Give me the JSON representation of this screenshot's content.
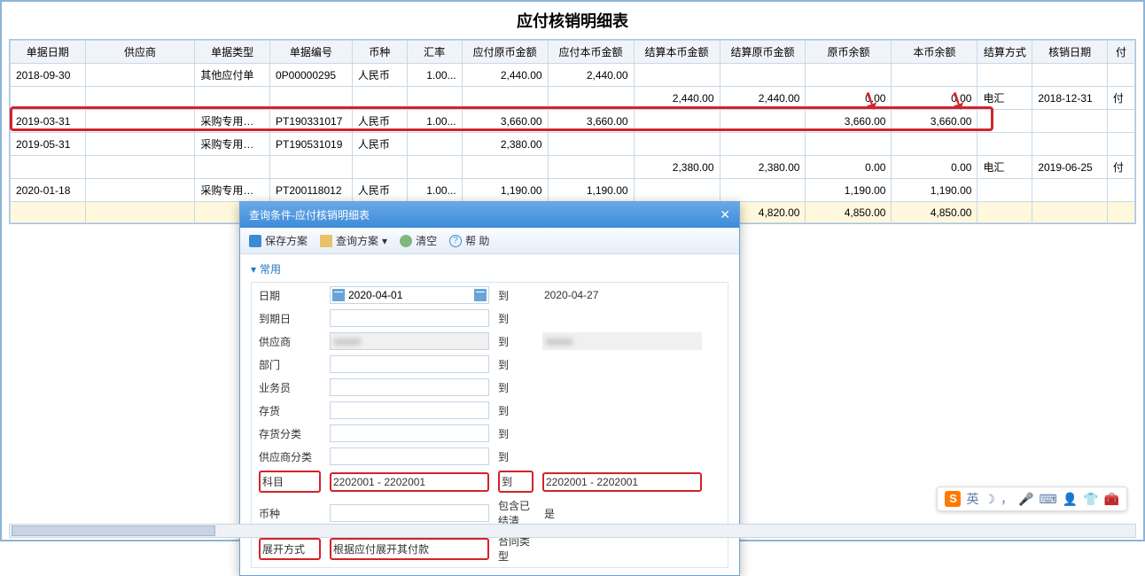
{
  "page_title": "应付核销明细表",
  "columns": [
    "单据日期",
    "供应商",
    "单据类型",
    "单据编号",
    "币种",
    "汇率",
    "应付原币金额",
    "应付本币金额",
    "结算本币金额",
    "结算原币金额",
    "原币余额",
    "本币余额",
    "结算方式",
    "核销日期",
    "付"
  ],
  "rows": [
    {
      "c": [
        "2018-09-30",
        "",
        "其他应付单",
        "0P00000295",
        "人民币",
        "1.00...",
        "2,440.00",
        "2,440.00",
        "",
        "",
        "",
        "",
        "",
        "",
        ""
      ]
    },
    {
      "c": [
        "",
        "",
        "",
        "",
        "",
        "",
        "",
        "",
        "2,440.00",
        "2,440.00",
        "0.00",
        "0.00",
        "电汇",
        "2018-12-31",
        "付"
      ]
    },
    {
      "c": [
        "2019-03-31",
        "",
        "采购专用发票",
        "PT190331017",
        "人民币",
        "1.00...",
        "3,660.00",
        "3,660.00",
        "",
        "",
        "3,660.00",
        "3,660.00",
        "",
        "",
        ""
      ]
    },
    {
      "c": [
        "2019-05-31",
        "",
        "采购专用发票",
        "PT190531019",
        "人民币",
        "",
        "2,380.00",
        "",
        "",
        "",
        "",
        "",
        "",
        "",
        ""
      ]
    },
    {
      "c": [
        "",
        "",
        "",
        "",
        "",
        "",
        "",
        "",
        "2,380.00",
        "2,380.00",
        "0.00",
        "0.00",
        "电汇",
        "2019-06-25",
        "付"
      ]
    },
    {
      "c": [
        "2020-01-18",
        "",
        "采购专用发票",
        "PT200118012",
        "人民币",
        "1.00...",
        "1,190.00",
        "1,190.00",
        "",
        "",
        "1,190.00",
        "1,190.00",
        "",
        "",
        ""
      ]
    },
    {
      "c": [
        "",
        "",
        "",
        "",
        "",
        "",
        "",
        "",
        "",
        "4,820.00",
        "4,850.00",
        "4,850.00",
        "",
        "",
        ""
      ],
      "total": true
    }
  ],
  "dialog": {
    "title": "查询条件-应付核销明细表",
    "toolbar": {
      "save": "保存方案",
      "query": "查询方案",
      "dropdown": "▾",
      "clear": "清空",
      "help": "帮 助"
    },
    "section": "常用",
    "labels": {
      "date": "日期",
      "to": "到",
      "due": "到期日",
      "supplier": "供应商",
      "dept": "部门",
      "clerk": "业务员",
      "stock": "存货",
      "stockcat": "存货分类",
      "suppliercat": "供应商分类",
      "subject": "科目",
      "currency": "币种",
      "settled": "包含已结清",
      "settled_val": "是",
      "expand": "展开方式",
      "contract": "合同类型"
    },
    "values": {
      "date_from": "2020-04-01",
      "date_to": "2020-04-27",
      "subject_from": "2202001 - 2202001",
      "subject_to": "2202001 - 2202001",
      "expand": "根据应付展开其付款"
    }
  },
  "ime": {
    "logo": "S",
    "label": "英"
  }
}
